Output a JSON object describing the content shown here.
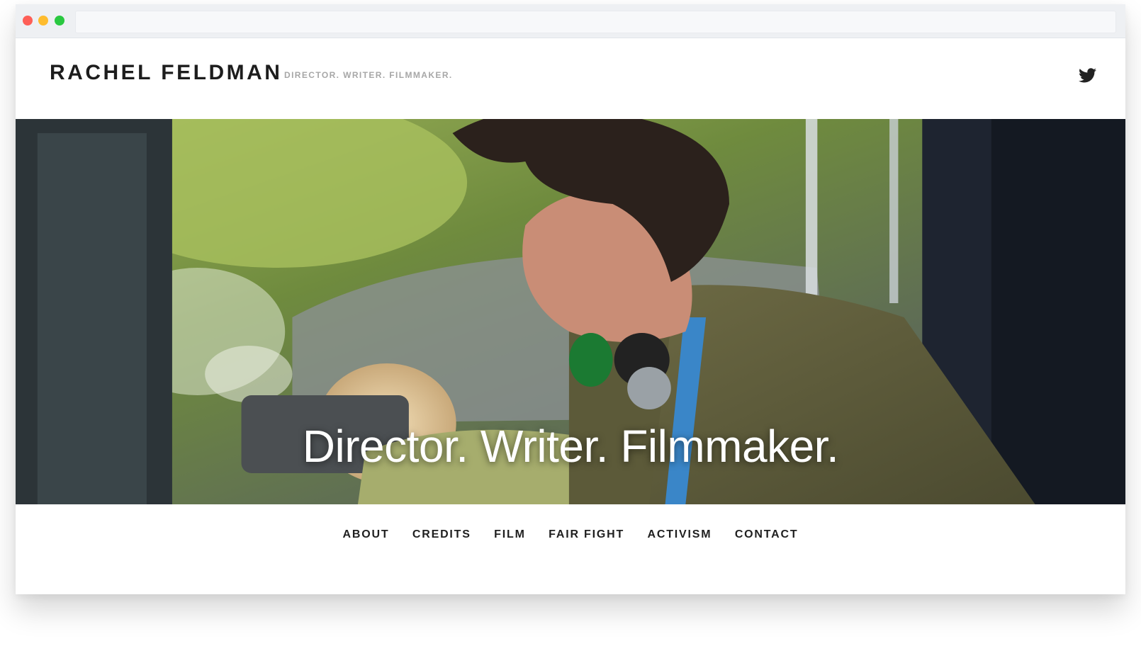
{
  "site": {
    "title": "RACHEL FELDMAN",
    "tagline": "DIRECTOR. WRITER. FILMMAKER."
  },
  "social": {
    "icon": "twitter-icon"
  },
  "hero": {
    "caption": "Director. Writer. Filmmaker."
  },
  "nav": {
    "items": [
      {
        "label": "ABOUT"
      },
      {
        "label": "CREDITS"
      },
      {
        "label": "FILM"
      },
      {
        "label": "FAIR FIGHT"
      },
      {
        "label": "ACTIVISM"
      },
      {
        "label": "CONTACT"
      }
    ]
  },
  "colors": {
    "traffic_red": "#fe5f57",
    "traffic_yellow": "#febc2e",
    "traffic_green": "#29c840",
    "text_dark": "#1d1d1d",
    "tagline_gray": "#a7a7a7"
  }
}
